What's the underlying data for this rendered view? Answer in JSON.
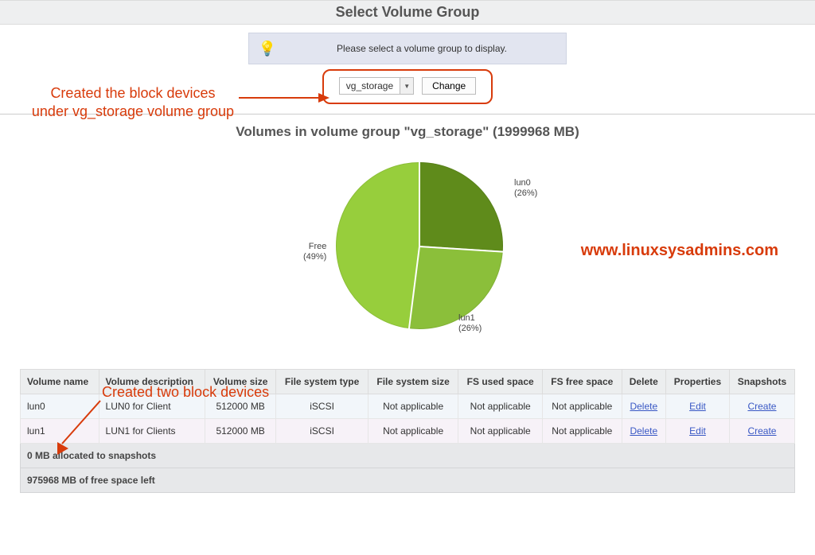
{
  "header": {
    "title": "Select Volume Group"
  },
  "info": {
    "icon": "lightbulb-icon",
    "message": "Please select a volume group to display."
  },
  "selector": {
    "value": "vg_storage",
    "change_label": "Change"
  },
  "section": {
    "heading": "Volumes in volume group \"vg_storage\" (1999968 MB)"
  },
  "chart_data": {
    "type": "pie",
    "title": "",
    "series": [
      {
        "name": "lun0",
        "value": 26
      },
      {
        "name": "lun1",
        "value": 26
      },
      {
        "name": "Free",
        "value": 49
      }
    ],
    "labels": {
      "lun0": {
        "name": "lun0",
        "pct": "(26%)"
      },
      "lun1": {
        "name": "lun1",
        "pct": "(26%)"
      },
      "free": {
        "name": "Free",
        "pct": "(49%)"
      }
    }
  },
  "watermark": "www.linuxsysadmins.com",
  "annotations": {
    "a1_line1": "Created the block devices",
    "a1_line2": "under vg_storage volume group",
    "a2": "Created two block devices"
  },
  "table": {
    "headers": {
      "name": "Volume name",
      "desc": "Volume description",
      "size": "Volume size",
      "fstype": "File system type",
      "fssize": "File system size",
      "used": "FS used space",
      "free": "FS free space",
      "delete": "Delete",
      "props": "Properties",
      "snaps": "Snapshots"
    },
    "rows": [
      {
        "name": "lun0",
        "desc": "LUN0 for Client",
        "size": "512000 MB",
        "fstype": "iSCSI",
        "fssize": "Not applicable",
        "used": "Not applicable",
        "free": "Not applicable",
        "delete": "Delete",
        "props": "Edit",
        "snaps": "Create"
      },
      {
        "name": "lun1",
        "desc": "LUN1 for Clients",
        "size": "512000 MB",
        "fstype": "iSCSI",
        "fssize": "Not applicable",
        "used": "Not applicable",
        "free": "Not applicable",
        "delete": "Delete",
        "props": "Edit",
        "snaps": "Create"
      }
    ],
    "footer1": "0 MB allocated to snapshots",
    "footer2": "975968 MB of free space left"
  }
}
